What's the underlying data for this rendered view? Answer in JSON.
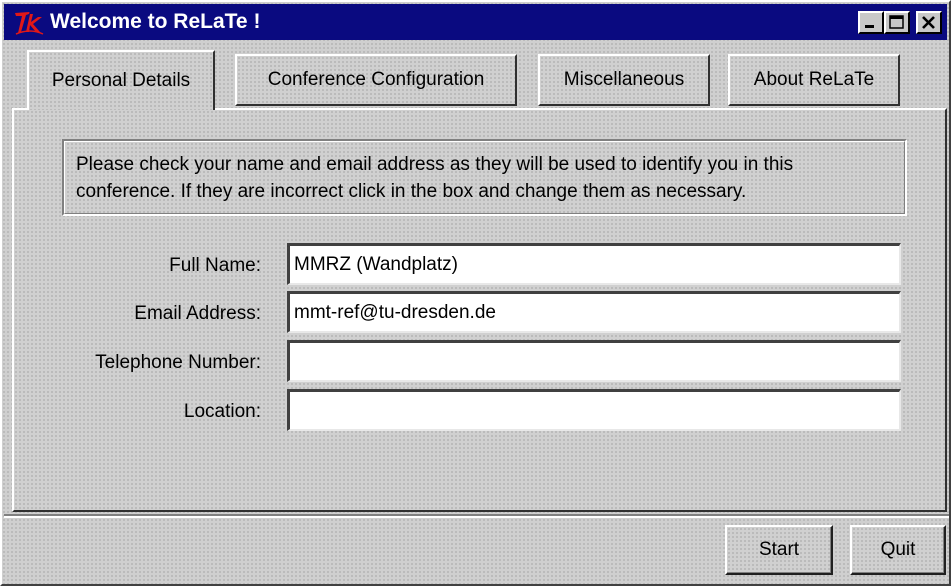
{
  "window": {
    "title": "Welcome to ReLaTe !",
    "logo_text": "Tk",
    "title_bar_color": "#0a0a80",
    "controls": {
      "minimize_icon": "minimize-icon",
      "maximize_icon": "maximize-icon",
      "close_icon": "close-icon"
    }
  },
  "tabs": [
    {
      "label": "Personal Details",
      "active": true
    },
    {
      "label": "Conference Configuration",
      "active": false
    },
    {
      "label": "Miscellaneous",
      "active": false
    },
    {
      "label": "About ReLaTe",
      "active": false
    }
  ],
  "info_text": "Please check your name and email address as they will be used to identify you in this conference. If they are incorrect click in the box and change them as necessary.",
  "form": {
    "full_name_label": "Full Name:",
    "full_name_value": "MMRZ (Wandplatz)",
    "email_label": "Email Address:",
    "email_value": "mmt-ref@tu-dresden.de",
    "telephone_label": "Telephone Number:",
    "telephone_value": "",
    "location_label": "Location:",
    "location_value": ""
  },
  "buttons": {
    "start_label": "Start",
    "quit_label": "Quit"
  }
}
